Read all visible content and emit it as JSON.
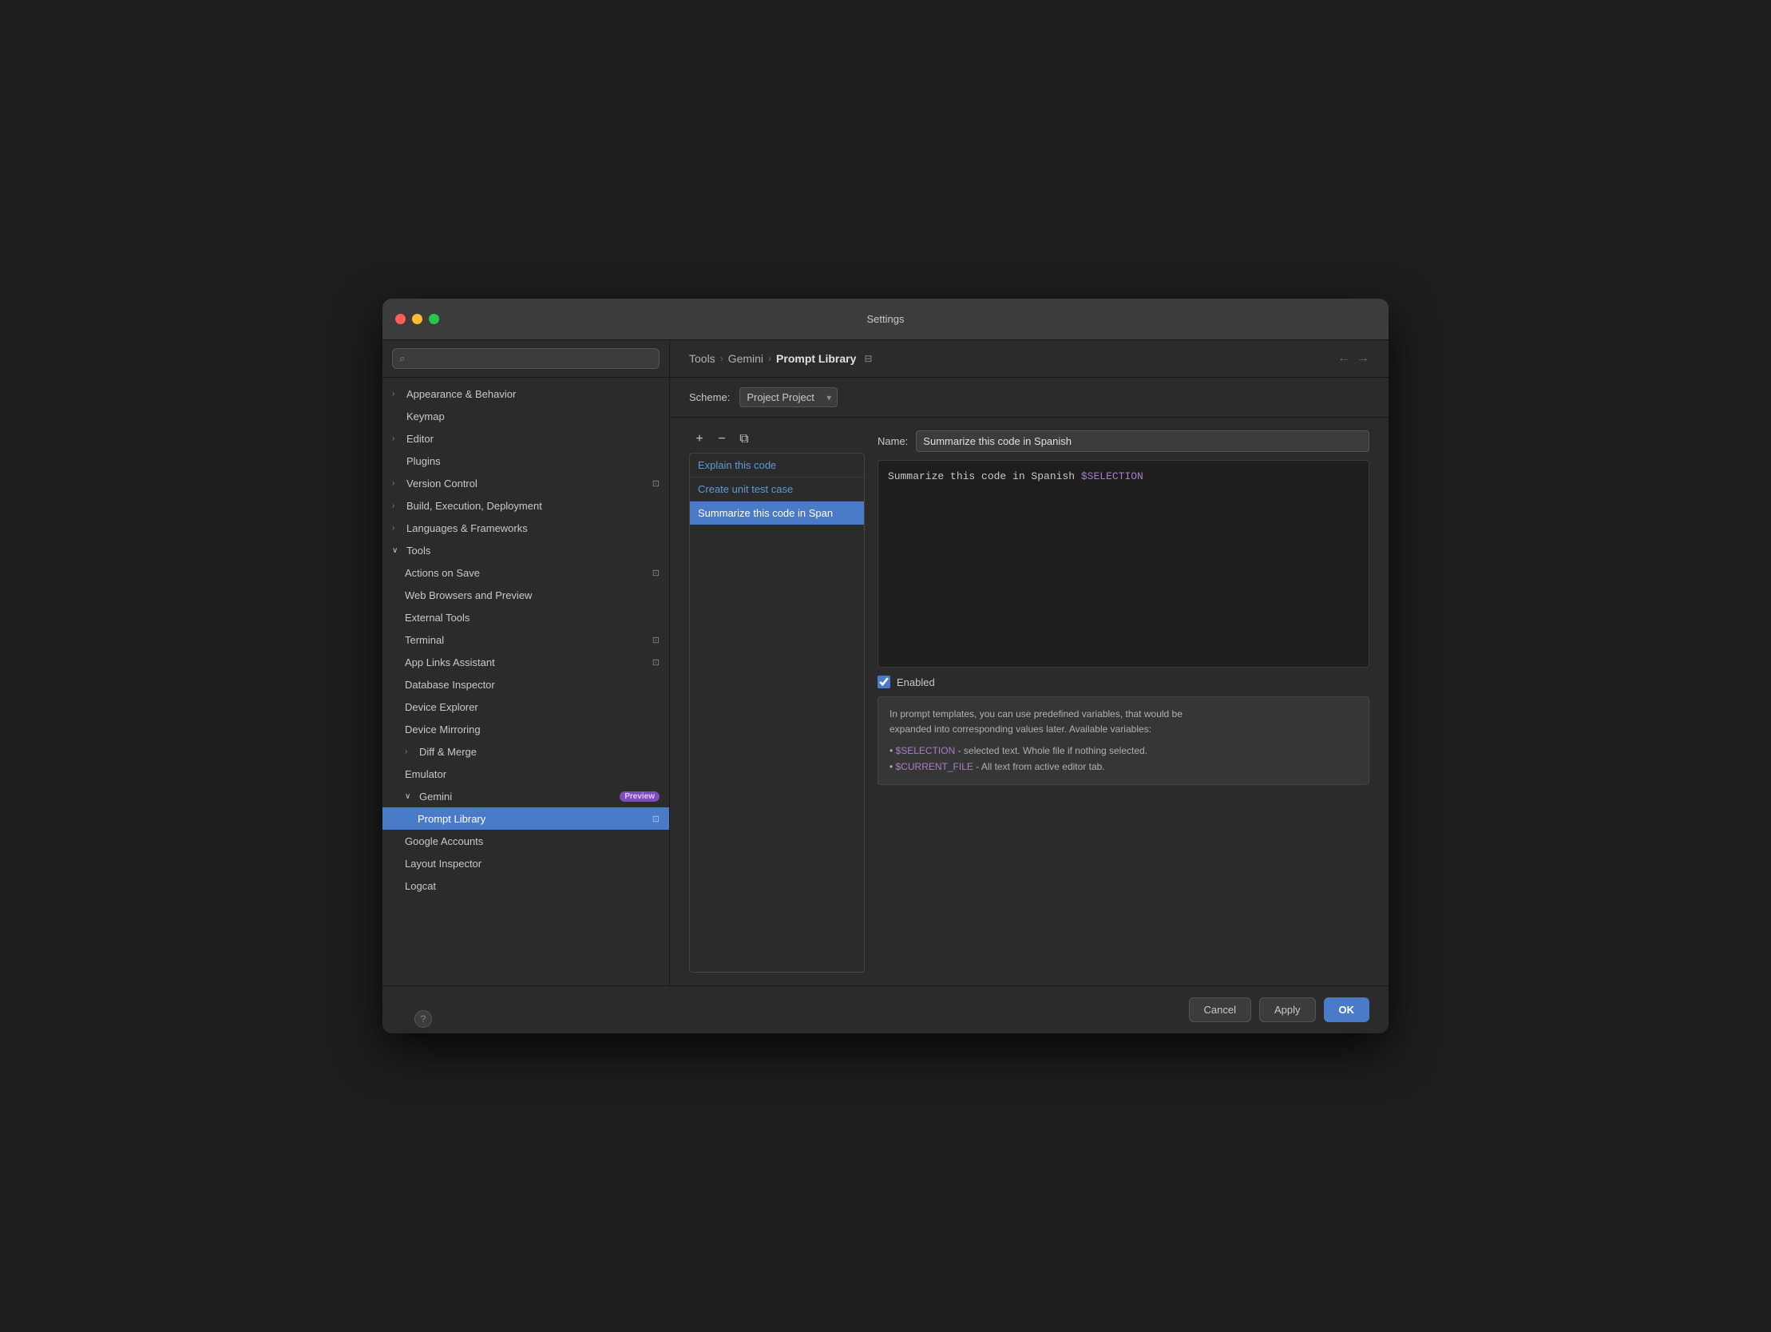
{
  "window": {
    "title": "Settings"
  },
  "titlebar": {
    "title": "Settings"
  },
  "sidebar": {
    "search_placeholder": "",
    "search_icon": "🔍",
    "items": [
      {
        "id": "appearance",
        "label": "Appearance & Behavior",
        "level": 0,
        "has_chevron": true,
        "chevron_state": "closed",
        "selected": false
      },
      {
        "id": "keymap",
        "label": "Keymap",
        "level": 0,
        "has_chevron": false,
        "selected": false
      },
      {
        "id": "editor",
        "label": "Editor",
        "level": 0,
        "has_chevron": true,
        "chevron_state": "closed",
        "selected": false
      },
      {
        "id": "plugins",
        "label": "Plugins",
        "level": 0,
        "has_chevron": false,
        "selected": false
      },
      {
        "id": "version-control",
        "label": "Version Control",
        "level": 0,
        "has_chevron": true,
        "chevron_state": "closed",
        "selected": false,
        "has_indicator": true
      },
      {
        "id": "build",
        "label": "Build, Execution, Deployment",
        "level": 0,
        "has_chevron": true,
        "chevron_state": "closed",
        "selected": false
      },
      {
        "id": "languages",
        "label": "Languages & Frameworks",
        "level": 0,
        "has_chevron": true,
        "chevron_state": "closed",
        "selected": false
      },
      {
        "id": "tools",
        "label": "Tools",
        "level": 0,
        "has_chevron": true,
        "chevron_state": "open",
        "selected": false
      },
      {
        "id": "actions-on-save",
        "label": "Actions on Save",
        "level": 1,
        "has_chevron": false,
        "selected": false,
        "has_indicator": true
      },
      {
        "id": "web-browsers",
        "label": "Web Browsers and Preview",
        "level": 1,
        "has_chevron": false,
        "selected": false
      },
      {
        "id": "external-tools",
        "label": "External Tools",
        "level": 1,
        "has_chevron": false,
        "selected": false
      },
      {
        "id": "terminal",
        "label": "Terminal",
        "level": 1,
        "has_chevron": false,
        "selected": false,
        "has_indicator": true
      },
      {
        "id": "app-links",
        "label": "App Links Assistant",
        "level": 1,
        "has_chevron": false,
        "selected": false,
        "has_indicator": true
      },
      {
        "id": "database-inspector",
        "label": "Database Inspector",
        "level": 1,
        "has_chevron": false,
        "selected": false
      },
      {
        "id": "device-explorer",
        "label": "Device Explorer",
        "level": 1,
        "has_chevron": false,
        "selected": false
      },
      {
        "id": "device-mirroring",
        "label": "Device Mirroring",
        "level": 1,
        "has_chevron": false,
        "selected": false
      },
      {
        "id": "diff-merge",
        "label": "Diff & Merge",
        "level": 1,
        "has_chevron": true,
        "chevron_state": "closed",
        "selected": false
      },
      {
        "id": "emulator",
        "label": "Emulator",
        "level": 1,
        "has_chevron": false,
        "selected": false
      },
      {
        "id": "gemini",
        "label": "Gemini",
        "level": 1,
        "has_chevron": true,
        "chevron_state": "open",
        "selected": false,
        "has_badge": true,
        "badge_text": "Preview"
      },
      {
        "id": "prompt-library",
        "label": "Prompt Library",
        "level": 2,
        "has_chevron": false,
        "selected": true,
        "has_indicator": true
      },
      {
        "id": "google-accounts",
        "label": "Google Accounts",
        "level": 1,
        "has_chevron": false,
        "selected": false
      },
      {
        "id": "layout-inspector",
        "label": "Layout Inspector",
        "level": 1,
        "has_chevron": false,
        "selected": false
      },
      {
        "id": "logcat",
        "label": "Logcat",
        "level": 1,
        "has_chevron": false,
        "selected": false
      }
    ]
  },
  "breadcrumb": {
    "items": [
      "Tools",
      "Gemini",
      "Prompt Library"
    ],
    "separators": [
      "›",
      "›"
    ]
  },
  "scheme": {
    "label": "Scheme:",
    "bold": "Project",
    "light": "Project"
  },
  "toolbar": {
    "add_label": "+",
    "remove_label": "−",
    "copy_label": "⧉"
  },
  "prompts": [
    {
      "id": "explain",
      "label": "Explain this code",
      "selected": false
    },
    {
      "id": "unit-test",
      "label": "Create unit test case",
      "selected": false
    },
    {
      "id": "summarize",
      "label": "Summarize this code in Span",
      "selected": true
    }
  ],
  "detail": {
    "name_label": "Name:",
    "name_value": "Summarize this code in Spanish",
    "prompt_text": "Summarize this code in Spanish $SELECTION",
    "prompt_keyword": "$SELECTION",
    "enabled_label": "Enabled",
    "enabled": true,
    "info_text_line1": "In prompt templates, you can use predefined variables, that would be",
    "info_text_line2": "expanded into corresponding values later. Available variables:",
    "info_bullets": [
      "• $SELECTION - selected text. Whole file if nothing selected.",
      "• $CURRENT_FILE - All text from active editor tab."
    ]
  },
  "footer": {
    "cancel_label": "Cancel",
    "apply_label": "Apply",
    "ok_label": "OK",
    "help_label": "?"
  }
}
